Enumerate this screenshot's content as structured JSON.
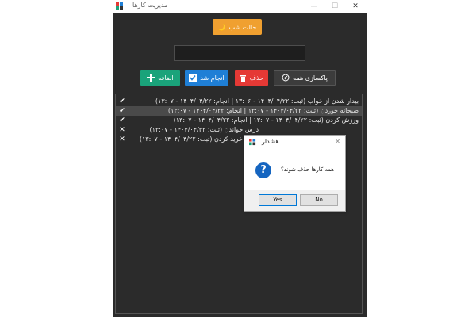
{
  "window": {
    "title": "مدیریت کارها",
    "controls": {
      "minimize": "—",
      "maximize": "☐",
      "close": "✕"
    }
  },
  "toolbar": {
    "dark_mode_label": "حالت شب",
    "dark_mode_icon": "🌙",
    "task_input": {
      "value": "",
      "placeholder": ""
    },
    "buttons": {
      "clear_all": {
        "label": "پاکسازی همه",
        "icon": "broom-icon"
      },
      "delete": {
        "label": "حذف",
        "icon": "trash-icon"
      },
      "done": {
        "label": "انجام شد",
        "icon": "check-icon"
      },
      "add": {
        "label": "اضافه",
        "icon": "plus-icon"
      }
    }
  },
  "tasks": [
    {
      "mark": "✔",
      "text": "بیدار شدن از خواب (ثبت: ۱۴۰۴/۰۴/۲۲ - ۱۳:۰۶ | انجام: ۱۴۰۴/۰۴/۲۲ - ۱۳:۰۷)",
      "selected": false
    },
    {
      "mark": "✔",
      "text": "صبحانه خوردن (ثبت: ۱۴۰۴/۰۴/۲۲ - ۱۳:۰۷ | انجام: ۱۴۰۴/۰۴/۲۲ - ۱۳:۰۷)",
      "selected": true
    },
    {
      "mark": "✔",
      "text": "ورزش کردن (ثبت: ۱۴۰۴/۰۴/۲۲ - ۱۳:۰۷ | انجام: ۱۴۰۴/۰۴/۲۲ - ۱۳:۰۷)",
      "selected": false
    },
    {
      "mark": "✕",
      "text": "درس خواندن (ثبت: ۱۴۰۴/۰۴/۲۲ - ۱۳:۰۷)",
      "selected": false
    },
    {
      "mark": "✕",
      "text": "خرید کردن (ثبت: ۱۴۰۴/۰۴/۲۲ - ۱۳:۰۷)",
      "selected": false
    }
  ],
  "dialog": {
    "title": "هشدار",
    "close": "✕",
    "icon": "question-icon",
    "question_mark": "?",
    "message": "همه کارها حذف شوند؟",
    "yes_label": "Yes",
    "no_label": "No"
  },
  "colors": {
    "dark_mode": "#f0a030",
    "delete": "#e53935",
    "done": "#1f7fd6",
    "add": "#1aa37a",
    "question": "#1565c0"
  }
}
